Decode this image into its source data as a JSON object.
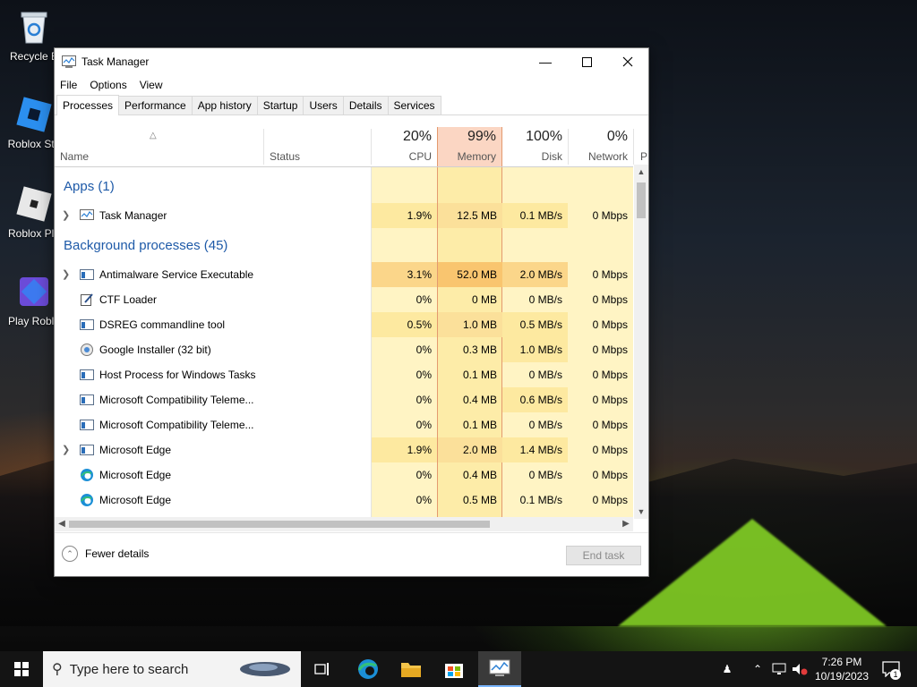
{
  "desktop": {
    "icons": [
      {
        "label": "Recycle B",
        "icon": "recycle-bin-icon"
      },
      {
        "label": "Roblox Stu",
        "icon": "roblox-studio-icon"
      },
      {
        "label": "Roblox Pla",
        "icon": "roblox-player-icon"
      },
      {
        "label": "Play Roblo",
        "icon": "play-roblox-icon"
      }
    ]
  },
  "window": {
    "title": "Task Manager",
    "menu": [
      "File",
      "Options",
      "View"
    ],
    "tabs": [
      "Processes",
      "Performance",
      "App history",
      "Startup",
      "Users",
      "Details",
      "Services"
    ],
    "active_tab": "Processes",
    "columns": {
      "name": "Name",
      "status": "Status",
      "cpu": {
        "pct": "20%",
        "label": "CPU"
      },
      "memory": {
        "pct": "99%",
        "label": "Memory"
      },
      "disk": {
        "pct": "100%",
        "label": "Disk"
      },
      "network": {
        "pct": "0%",
        "label": "Network"
      },
      "power_partial": "P"
    },
    "groups": {
      "apps": "Apps (1)",
      "background": "Background processes (45)"
    },
    "rows": [
      {
        "name": "Task Manager",
        "cpu": "1.9%",
        "mem": "12.5 MB",
        "disk": "0.1 MB/s",
        "net": "0 Mbps",
        "icon": "task-manager-icon",
        "expandable": true
      },
      {
        "name": "Antimalware Service Executable",
        "cpu": "3.1%",
        "mem": "52.0 MB",
        "disk": "2.0 MB/s",
        "net": "0 Mbps",
        "icon": "service-window-icon",
        "expandable": true
      },
      {
        "name": "CTF Loader",
        "cpu": "0%",
        "mem": "0 MB",
        "disk": "0 MB/s",
        "net": "0 Mbps",
        "icon": "ctf-loader-icon",
        "expandable": false
      },
      {
        "name": "DSREG commandline tool",
        "cpu": "0.5%",
        "mem": "1.0 MB",
        "disk": "0.5 MB/s",
        "net": "0 Mbps",
        "icon": "service-window-icon",
        "expandable": false
      },
      {
        "name": "Google Installer (32 bit)",
        "cpu": "0%",
        "mem": "0.3 MB",
        "disk": "1.0 MB/s",
        "net": "0 Mbps",
        "icon": "google-installer-icon",
        "expandable": false
      },
      {
        "name": "Host Process for Windows Tasks",
        "cpu": "0%",
        "mem": "0.1 MB",
        "disk": "0 MB/s",
        "net": "0 Mbps",
        "icon": "service-window-icon",
        "expandable": false
      },
      {
        "name": "Microsoft Compatibility Teleme...",
        "cpu": "0%",
        "mem": "0.4 MB",
        "disk": "0.6 MB/s",
        "net": "0 Mbps",
        "icon": "service-window-icon",
        "expandable": false
      },
      {
        "name": "Microsoft Compatibility Teleme...",
        "cpu": "0%",
        "mem": "0.1 MB",
        "disk": "0 MB/s",
        "net": "0 Mbps",
        "icon": "service-window-icon",
        "expandable": false
      },
      {
        "name": "Microsoft Edge",
        "cpu": "1.9%",
        "mem": "2.0 MB",
        "disk": "1.4 MB/s",
        "net": "0 Mbps",
        "icon": "service-window-icon",
        "expandable": true
      },
      {
        "name": "Microsoft Edge",
        "cpu": "0%",
        "mem": "0.4 MB",
        "disk": "0 MB/s",
        "net": "0 Mbps",
        "icon": "edge-icon",
        "expandable": false
      },
      {
        "name": "Microsoft Edge",
        "cpu": "0%",
        "mem": "0.5 MB",
        "disk": "0.1 MB/s",
        "net": "0 Mbps",
        "icon": "edge-icon",
        "expandable": false
      }
    ],
    "footer": {
      "fewer_details": "Fewer details",
      "end_task": "End task"
    }
  },
  "taskbar": {
    "search_placeholder": "Type here to search",
    "time": "7:26 PM",
    "date": "10/19/2023",
    "notification_count": "1"
  },
  "colors": {
    "accent_blue": "#1e5aa8",
    "memory_header": "#fbd6c3",
    "memory_border": "#e49a6f",
    "heat_low": "#fff4c4",
    "heat_mid": "#fde9a0",
    "heat_high": "#fbd68a"
  }
}
